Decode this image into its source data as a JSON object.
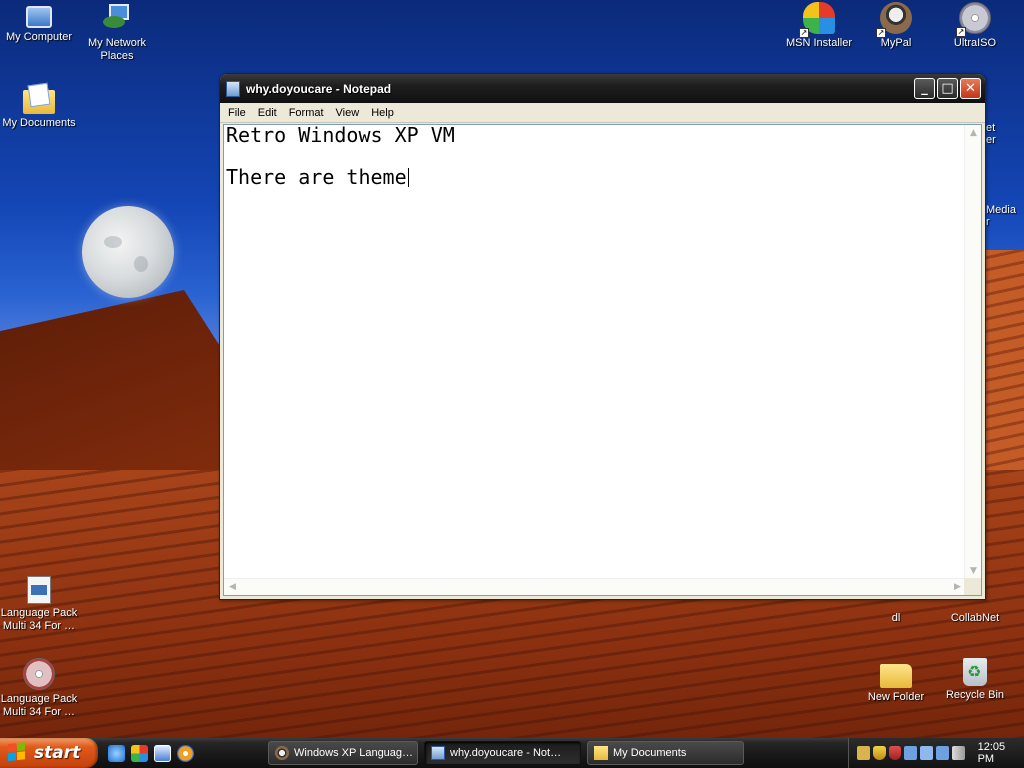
{
  "desktop": {
    "icons_left": [
      {
        "label": "My Computer",
        "icon": "my-computer-icon"
      },
      {
        "label": "My Network Places",
        "icon": "network-places-icon"
      },
      {
        "label": "My Documents",
        "icon": "my-documents-icon"
      },
      {
        "label": "Language Pack Multi 34 For …",
        "icon": "setup-file-icon"
      },
      {
        "label": "Language Pack Multi 34 For …",
        "icon": "disc-image-icon"
      }
    ],
    "icons_right": [
      {
        "label": "MSN Installer",
        "icon": "msn-icon"
      },
      {
        "label": "MyPal",
        "icon": "mypal-icon"
      },
      {
        "label": "UltraISO",
        "icon": "ultraiso-icon"
      },
      {
        "label": "dl",
        "icon": "folder-icon"
      },
      {
        "label": "CollabNet",
        "icon": "collabnet-icon"
      },
      {
        "label": "New Folder",
        "icon": "folder-icon"
      },
      {
        "label": "Recycle Bin",
        "icon": "recycle-bin-icon"
      }
    ],
    "partial_labels": [
      "et",
      "er",
      "Media",
      "r"
    ]
  },
  "notepad": {
    "title": "why.doyoucare - Notepad",
    "menu": [
      "File",
      "Edit",
      "Format",
      "View",
      "Help"
    ],
    "lines": [
      "Retro Windows XP VM",
      "",
      "There are theme"
    ]
  },
  "taskbar": {
    "start_label": "start",
    "quick_launch": [
      "internet-explorer-icon",
      "paint-icon",
      "ie-alt-icon",
      "media-player-icon"
    ],
    "tasks": [
      {
        "label": "Windows XP Languag…",
        "icon": "mypal-icon",
        "active": false
      },
      {
        "label": "why.doyoucare - Not…",
        "icon": "notepad-icon",
        "active": true
      },
      {
        "label": "My Documents",
        "icon": "folder-icon",
        "active": false
      }
    ],
    "tray_icons": [
      "key-icon",
      "shield-icon",
      "security-icon",
      "network-icon",
      "network-icon",
      "network-icon",
      "speaker-icon"
    ],
    "clock": "12:05 PM"
  },
  "colors": {
    "start_orange": "#e05a1a",
    "titlebar_dark": "#1e1e1e",
    "close_red": "#c2361a"
  }
}
